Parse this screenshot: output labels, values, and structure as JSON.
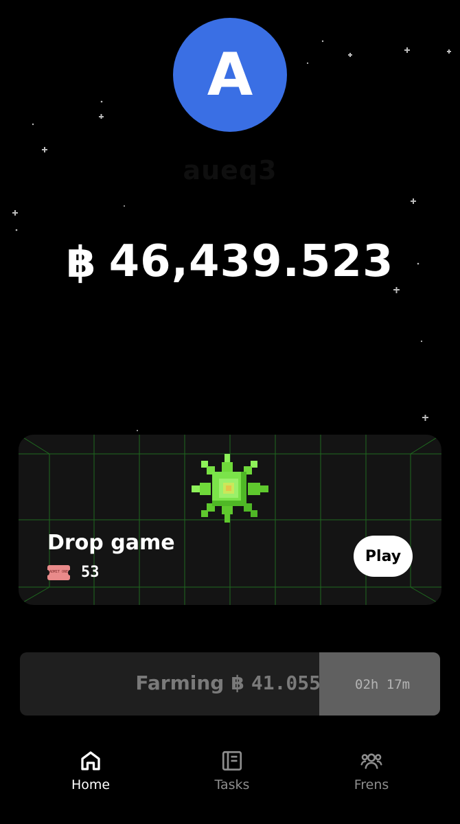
{
  "profile": {
    "avatar_letter": "A",
    "avatar_color": "#3a6fe4",
    "username": "aueq3"
  },
  "balance": {
    "symbol": "฿",
    "amount": "46,439.523"
  },
  "drop_game": {
    "title": "Drop game",
    "ticket_icon_text": "ADMIT ONE",
    "ticket_count": "53",
    "play_label": "Play",
    "image": "green-pixel-star-icon"
  },
  "farming": {
    "label": "Farming",
    "symbol": "฿",
    "amount": "41.055",
    "time_remaining": "02h 17m",
    "progress_fraction": 0.71
  },
  "nav": {
    "items": [
      {
        "label": "Home",
        "icon": "home-icon",
        "active": true
      },
      {
        "label": "Tasks",
        "icon": "tasks-icon",
        "active": false
      },
      {
        "label": "Frens",
        "icon": "frens-icon",
        "active": false
      }
    ]
  },
  "colors": {
    "background": "#000000",
    "card": "#141414",
    "grid_line": "#1f6a1f",
    "accent_green": "#7be34a",
    "farming_bg": "#1f1f1f",
    "farming_fill": "#606060"
  }
}
